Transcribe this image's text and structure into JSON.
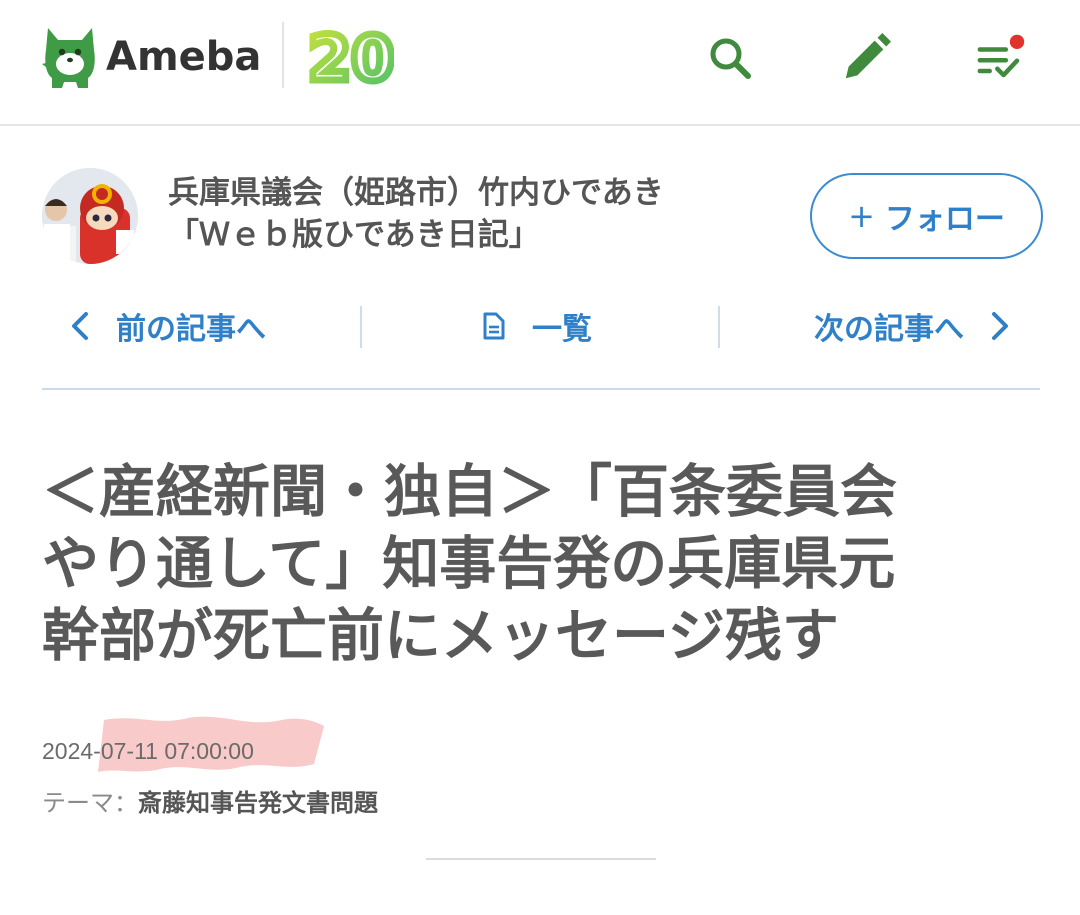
{
  "header": {
    "logo_text": "Ameba",
    "anniversary_badge": "20",
    "icons": [
      "search-icon",
      "pen-icon",
      "feed-check-icon"
    ],
    "accent_color": "#3f8a3d",
    "notification_dot_color": "#e0332b"
  },
  "owner": {
    "blog_name_line1": "兵庫県議会（姫路市）竹内ひであき",
    "blog_name_line2": "「Ｗｅｂ版ひであき日記」",
    "follow_plus": "+",
    "follow_label": "フォロー"
  },
  "nav": {
    "prev_label": "前の記事へ",
    "list_label": "一覧",
    "next_label": "次の記事へ",
    "link_color": "#2f80c8"
  },
  "article": {
    "title_line1": "＜産経新聞・独自＞「百条委員会",
    "title_line2": "やり通して」知事告発の兵庫県元",
    "title_line3": "幹部が死亡前にメッセージ残す",
    "date": "2024-07-11 07:00:00",
    "theme_label": "テーマ：",
    "theme_value": "斎藤知事告発文書問題"
  }
}
